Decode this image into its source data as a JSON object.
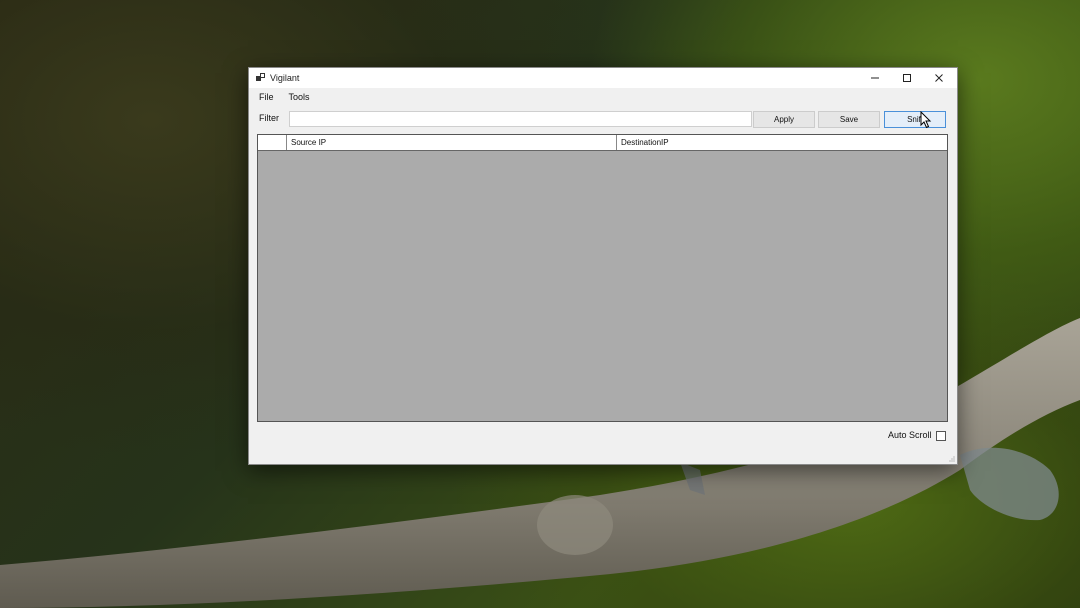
{
  "window": {
    "title": "Vigilant"
  },
  "menu": {
    "items": [
      "File",
      "Tools"
    ]
  },
  "filter": {
    "label": "Filter",
    "value": "",
    "placeholder": ""
  },
  "buttons": {
    "apply": "Apply",
    "save": "Save",
    "sniff": "Sniff"
  },
  "grid": {
    "columns": [
      "Source IP",
      "DestinationIP"
    ],
    "rows": []
  },
  "auto_scroll": {
    "label": "Auto Scroll",
    "checked": false
  },
  "colors": {
    "grid_background": "#ababab",
    "accent": "#4a90d9"
  }
}
